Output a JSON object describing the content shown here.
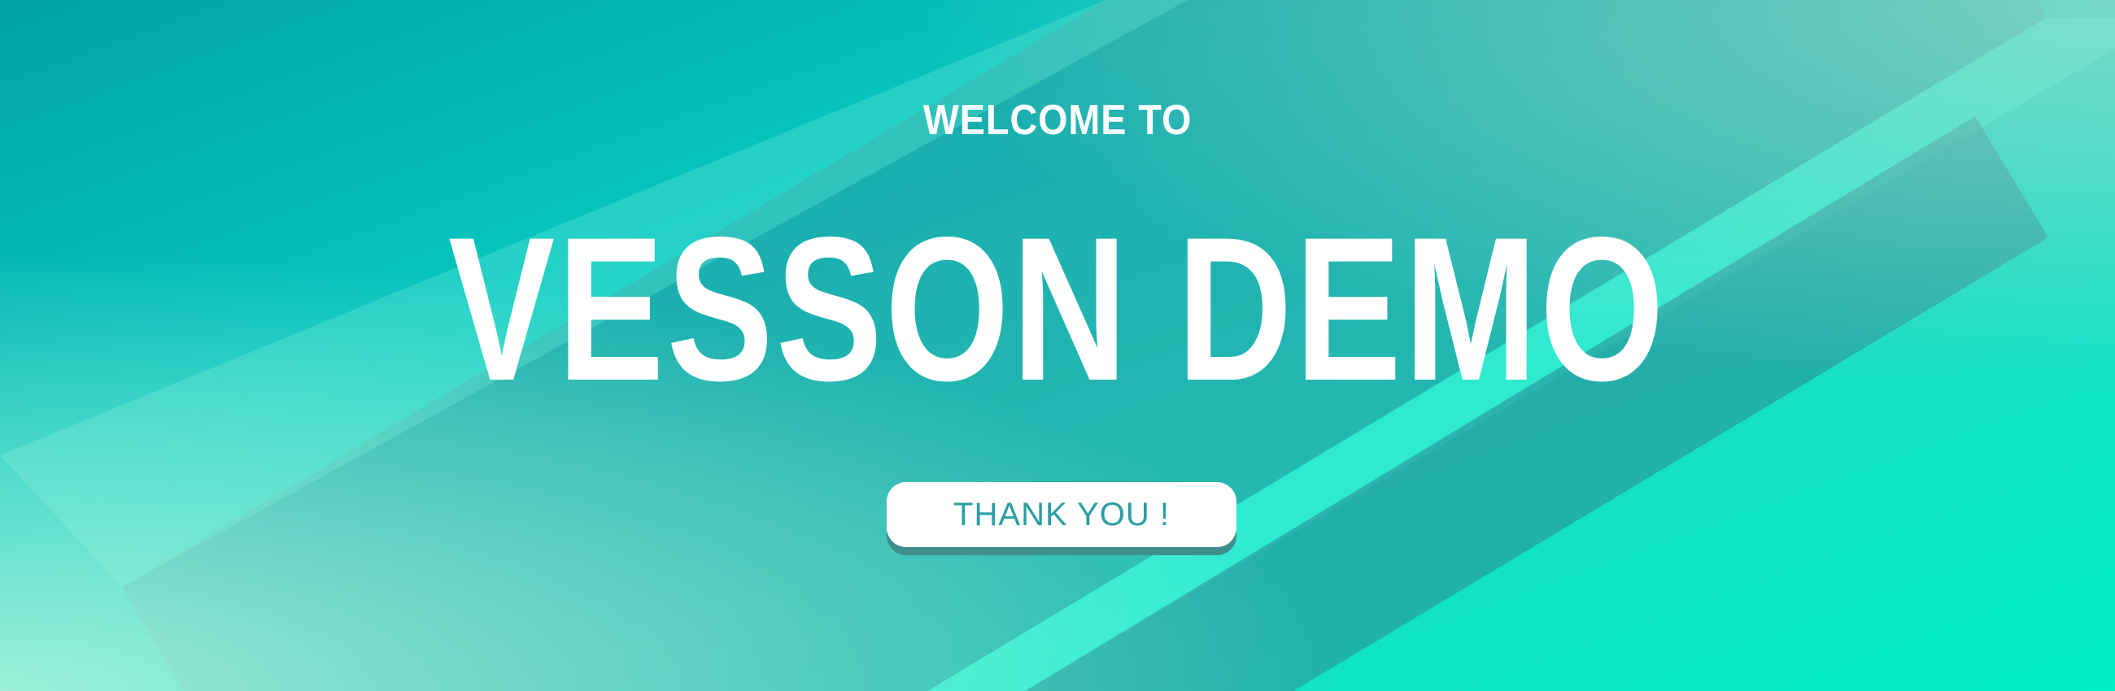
{
  "banner": {
    "welcome": "WELCOME TO",
    "title": "VESSON DEMO",
    "cta_label": "THANK YOU !"
  },
  "colors": {
    "accent_text": "#2a9ea3",
    "button_bg": "#ffffff",
    "button_shadow": "#3e8e8c",
    "headline": "#ffffff"
  }
}
